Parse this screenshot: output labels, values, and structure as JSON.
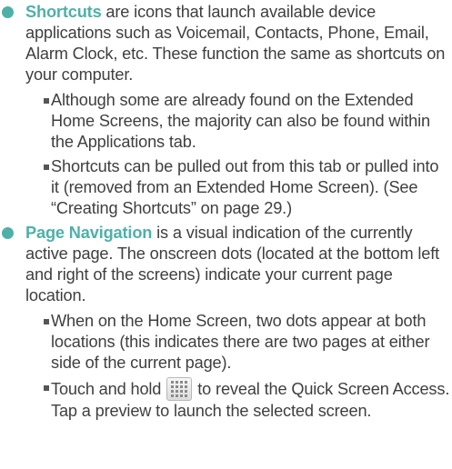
{
  "shortcuts": {
    "term": "Shortcuts",
    "text": " are icons that launch available device applications such as Voicemail, Contacts, Phone, Email, Alarm Clock, etc. These function the same as shortcuts on your computer.",
    "subitems": [
      "Although some are already found on the Extended Home Screens, the majority can also be found within the Applications tab.",
      "Shortcuts can be pulled out from this tab or pulled into it (removed from an Extended Home Screen). (See “Creating Shortcuts” on page 29.)"
    ]
  },
  "page_navigation": {
    "term": "Page Navigation",
    "text": " is a visual indication of the currently active page. The onscreen dots (located at the bottom left and right of the screens) indicate your current page location.",
    "subitems": [
      "When on the Home Screen, two dots appear at both locations (this indicates there are two pages at either side of the current page)."
    ],
    "touch_hold_before": "Touch and hold",
    "touch_hold_after": "to reveal the Quick Screen Access. Tap a preview to launch the selected screen.",
    "icon": "applications-grid-icon"
  },
  "colors": {
    "accent": "#4fb0a8",
    "text": "#3f3f3f"
  }
}
